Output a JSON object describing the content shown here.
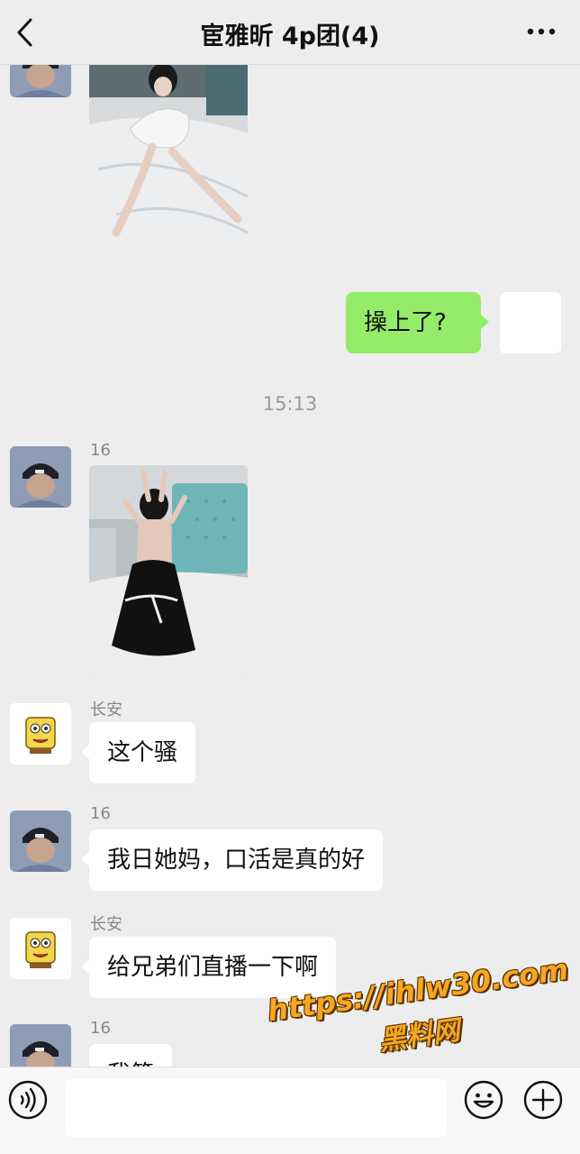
{
  "header": {
    "title": "宦雅昕 4p团(4)",
    "back_icon": "chevron-left-icon",
    "more_icon": "more-dots-icon"
  },
  "messages": {
    "right_text": "操上了?",
    "time_divider": "15:13",
    "sender_16": "16",
    "sender_changan": "长安",
    "text_1": "这个骚",
    "text_2": "我日她妈，口活是真的好",
    "text_3": "给兄弟们直播一下啊",
    "text_4_partial": "我第"
  },
  "watermark": {
    "url": "https://ihlw30.com",
    "name": "黑料网"
  },
  "input_bar": {
    "voice_icon": "voice-icon",
    "emoji_icon": "emoji-icon",
    "plus_icon": "plus-icon",
    "value": ""
  },
  "colors": {
    "background": "#ededed",
    "bubble_right": "#95ec69",
    "bubble_left": "#ffffff",
    "watermark": "#f6a721"
  }
}
